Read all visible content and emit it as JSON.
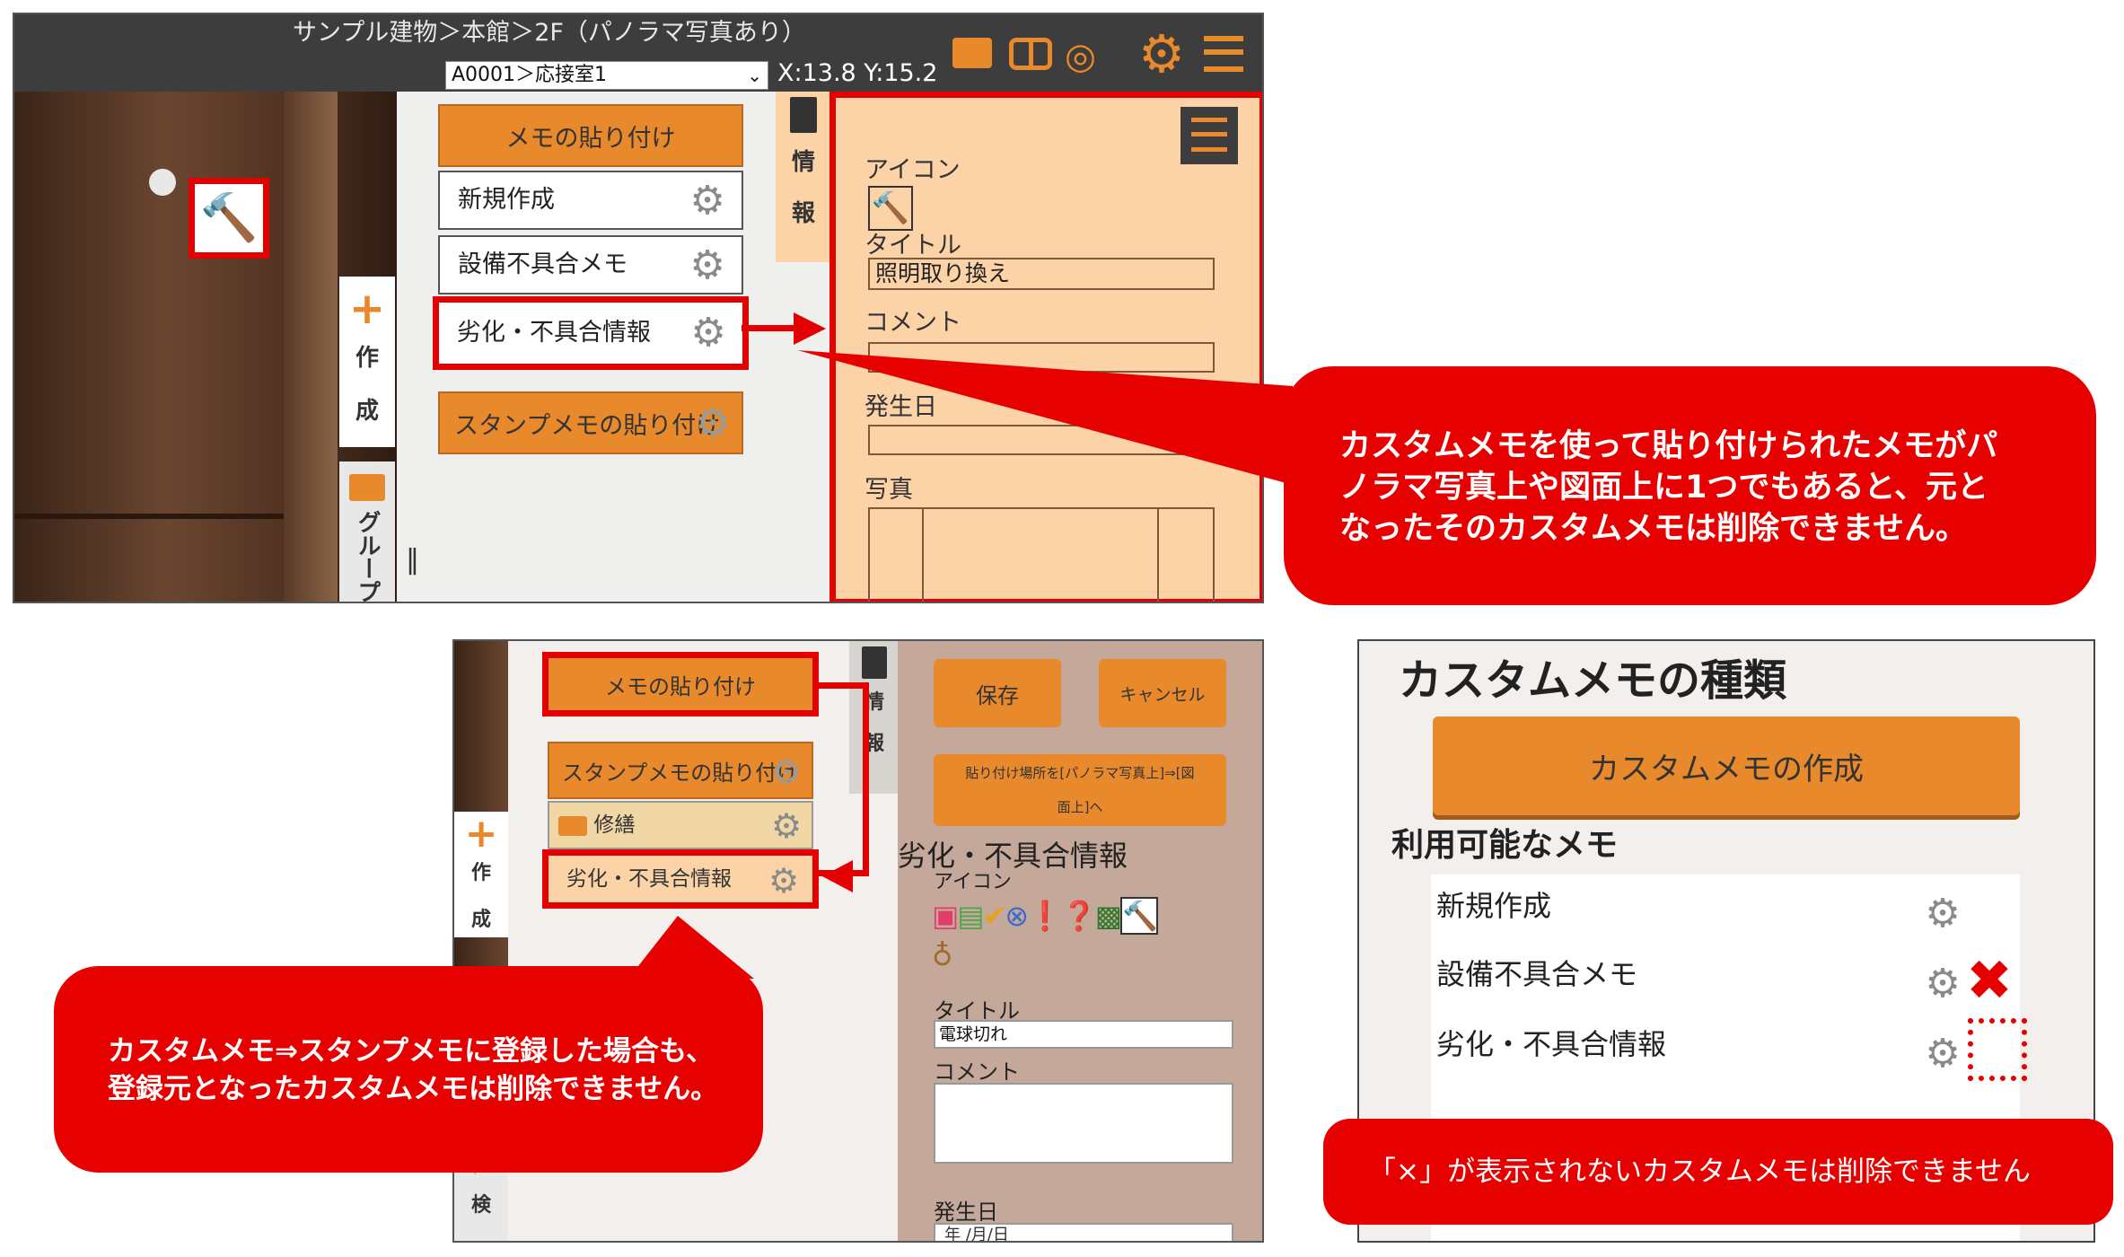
{
  "top_screen": {
    "breadcrumb": "サンプル建物＞本館＞2F（パノラマ写真あり）",
    "room_select": "A0001＞応接室1",
    "coords": "X:13.8 Y:15.2",
    "colors": {
      "header_bg": "#3d3d3d",
      "accent": "#e8892b",
      "alert": "#e60000"
    },
    "tabs": {
      "create_line1": "作",
      "create_line2": "成",
      "group": "グループ",
      "info_line1": "情",
      "info_line2": "報"
    },
    "menu": {
      "paste_label": "メモの貼り付け",
      "items": [
        "新規作成",
        "設備不具合メモ",
        "劣化・不具合情報"
      ],
      "stamp_paste_label": "スタンプメモの貼り付け"
    },
    "panel": {
      "icon_label": "アイコン",
      "title_label": "タイトル",
      "title_value": "照明取り換え",
      "comment_label": "コメント",
      "date_label": "発生日",
      "photo_label": "写真"
    }
  },
  "callout_top": {
    "line1": "カスタムメモを使って貼り付けられたメモがパ",
    "line2": "ノラマ写真上や図面上に1つでもあると、元と",
    "line3": "なったそのカスタムメモは削除できません。"
  },
  "bottom_left": {
    "paste_label": "メモの貼り付け",
    "stamp_paste_label": "スタンプメモの貼り付け",
    "folder_label": "修繕",
    "item_label": "劣化・不具合情報",
    "tabs": {
      "create_line1": "作",
      "create_line2": "成",
      "info_line1": "情",
      "info_line2": "報",
      "search": "検"
    },
    "buttons": {
      "save": "保存",
      "cancel": "キャンセル",
      "toggle_line1": "貼り付け場所を[パノラマ写真上]⇒[図",
      "toggle_line2": "面上]へ"
    },
    "form": {
      "heading": "劣化・不具合情報",
      "icon_label": "アイコン",
      "title_label": "タイトル",
      "title_value": "電球切れ",
      "comment_label": "コメント",
      "date_label": "発生日",
      "date_placeholder": "年 /月/日"
    }
  },
  "callout_bottom": {
    "line1": "カスタムメモ⇒スタンプメモに登録した場合も、",
    "line2": "登録元となったカスタムメモは削除できません。"
  },
  "right_panel": {
    "title": "カスタムメモの種類",
    "create_button": "カスタムメモの作成",
    "available_label": "利用可能なメモ",
    "items": [
      "新規作成",
      "設備不具合メモ",
      "劣化・不具合情報"
    ]
  },
  "callout_right": {
    "text": "「×」が表示されないカスタムメモは削除できません"
  }
}
